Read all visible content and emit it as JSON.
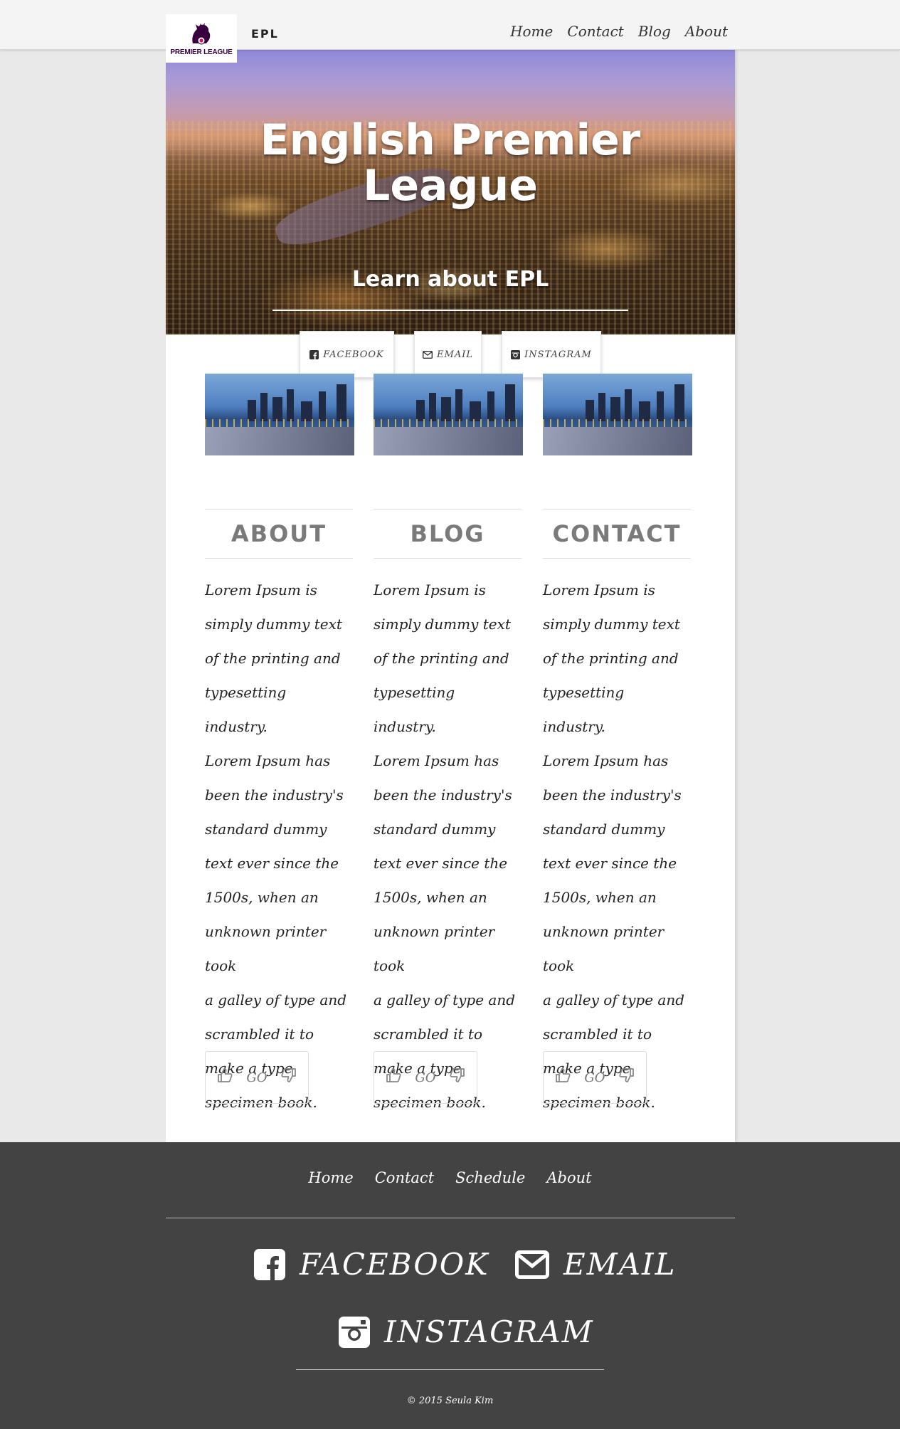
{
  "brand": {
    "logo_text": "PREMIER LEAGUE",
    "name": "EPL"
  },
  "nav": {
    "items": [
      "Home",
      "Contact",
      "Blog",
      "About"
    ]
  },
  "hero": {
    "title": "English Premier League",
    "subtitle": "Learn about EPL"
  },
  "social_buttons": [
    {
      "label": "FACEBOOK",
      "icon": "facebook-icon"
    },
    {
      "label": "EMAIL",
      "icon": "envelope-icon"
    },
    {
      "label": "INSTAGRAM",
      "icon": "instagram-icon"
    }
  ],
  "columns": [
    {
      "heading": "ABOUT",
      "lines": [
        "Lorem Ipsum is",
        "simply dummy text",
        "of the printing and",
        "typesetting industry.",
        "Lorem Ipsum has",
        "been the industry's",
        "standard dummy",
        "text ever since the",
        "1500s, when an",
        "unknown printer took",
        "a galley of type and",
        "scrambled it to",
        "make a type",
        "specimen book."
      ],
      "go_label": "GO"
    },
    {
      "heading": "BLOG",
      "lines": [
        "Lorem Ipsum is",
        "simply dummy text",
        "of the printing and",
        "typesetting industry.",
        "Lorem Ipsum has",
        "been the industry's",
        "standard dummy",
        "text ever since the",
        "1500s, when an",
        "unknown printer took",
        "a galley of type and",
        "scrambled it to",
        "make a type",
        "specimen book."
      ],
      "go_label": "GO"
    },
    {
      "heading": "CONTACT",
      "lines": [
        "Lorem Ipsum is",
        "simply dummy text",
        "of the printing and",
        "typesetting industry.",
        "Lorem Ipsum has",
        "been the industry's",
        "standard dummy",
        "text ever since the",
        "1500s, when an",
        "unknown printer took",
        "a galley of type and",
        "scrambled it to",
        "make a type",
        "specimen book."
      ],
      "go_label": "GO"
    }
  ],
  "footer": {
    "links": [
      "Home",
      "Contact",
      "Schedule",
      "About"
    ],
    "social": [
      {
        "label": "FACEBOOK",
        "icon": "facebook-icon"
      },
      {
        "label": "EMAIL",
        "icon": "envelope-icon"
      },
      {
        "label": "INSTAGRAM",
        "icon": "instagram-icon"
      }
    ],
    "copyright": "© 2015 Seula Kim"
  },
  "colors": {
    "page_bg": "#e9e9e9",
    "footer_bg": "#434343",
    "heading_gray": "#7a7a7a",
    "logo_purple": "#38003c"
  }
}
